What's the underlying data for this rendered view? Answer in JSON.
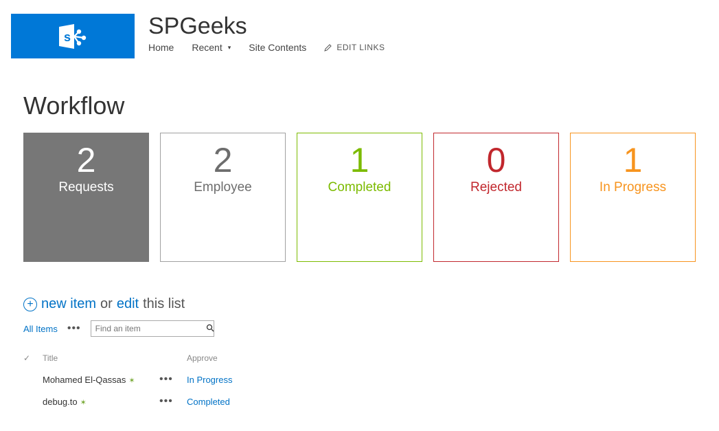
{
  "site": {
    "title": "SPGeeks"
  },
  "nav": {
    "home": "Home",
    "recent": "Recent",
    "site_contents": "Site Contents",
    "edit_links": "EDIT LINKS"
  },
  "page": {
    "title": "Workflow"
  },
  "tiles": [
    {
      "count": "2",
      "label": "Requests",
      "active": true,
      "border": "#777777",
      "color": "#ffffff"
    },
    {
      "count": "2",
      "label": "Employee",
      "active": false,
      "border": "#a0a0a0",
      "color": "#6d6d6d"
    },
    {
      "count": "1",
      "label": "Completed",
      "active": false,
      "border": "#7cbb00",
      "color": "#7cbb00"
    },
    {
      "count": "0",
      "label": "Rejected",
      "active": false,
      "border": "#c1272d",
      "color": "#c1272d"
    },
    {
      "count": "1",
      "label": "In Progress",
      "active": false,
      "border": "#f7941e",
      "color": "#f7941e"
    }
  ],
  "list_toolbar": {
    "new_item": "new item",
    "or": "or",
    "edit": "edit",
    "this_list": "this list"
  },
  "views": {
    "current": "All Items",
    "search_placeholder": "Find an item"
  },
  "columns": {
    "title": "Title",
    "approve": "Approve"
  },
  "rows": [
    {
      "title": "Mohamed El-Qassas",
      "is_new": true,
      "approve": "In Progress"
    },
    {
      "title": "debug.to",
      "is_new": true,
      "approve": "Completed"
    }
  ]
}
